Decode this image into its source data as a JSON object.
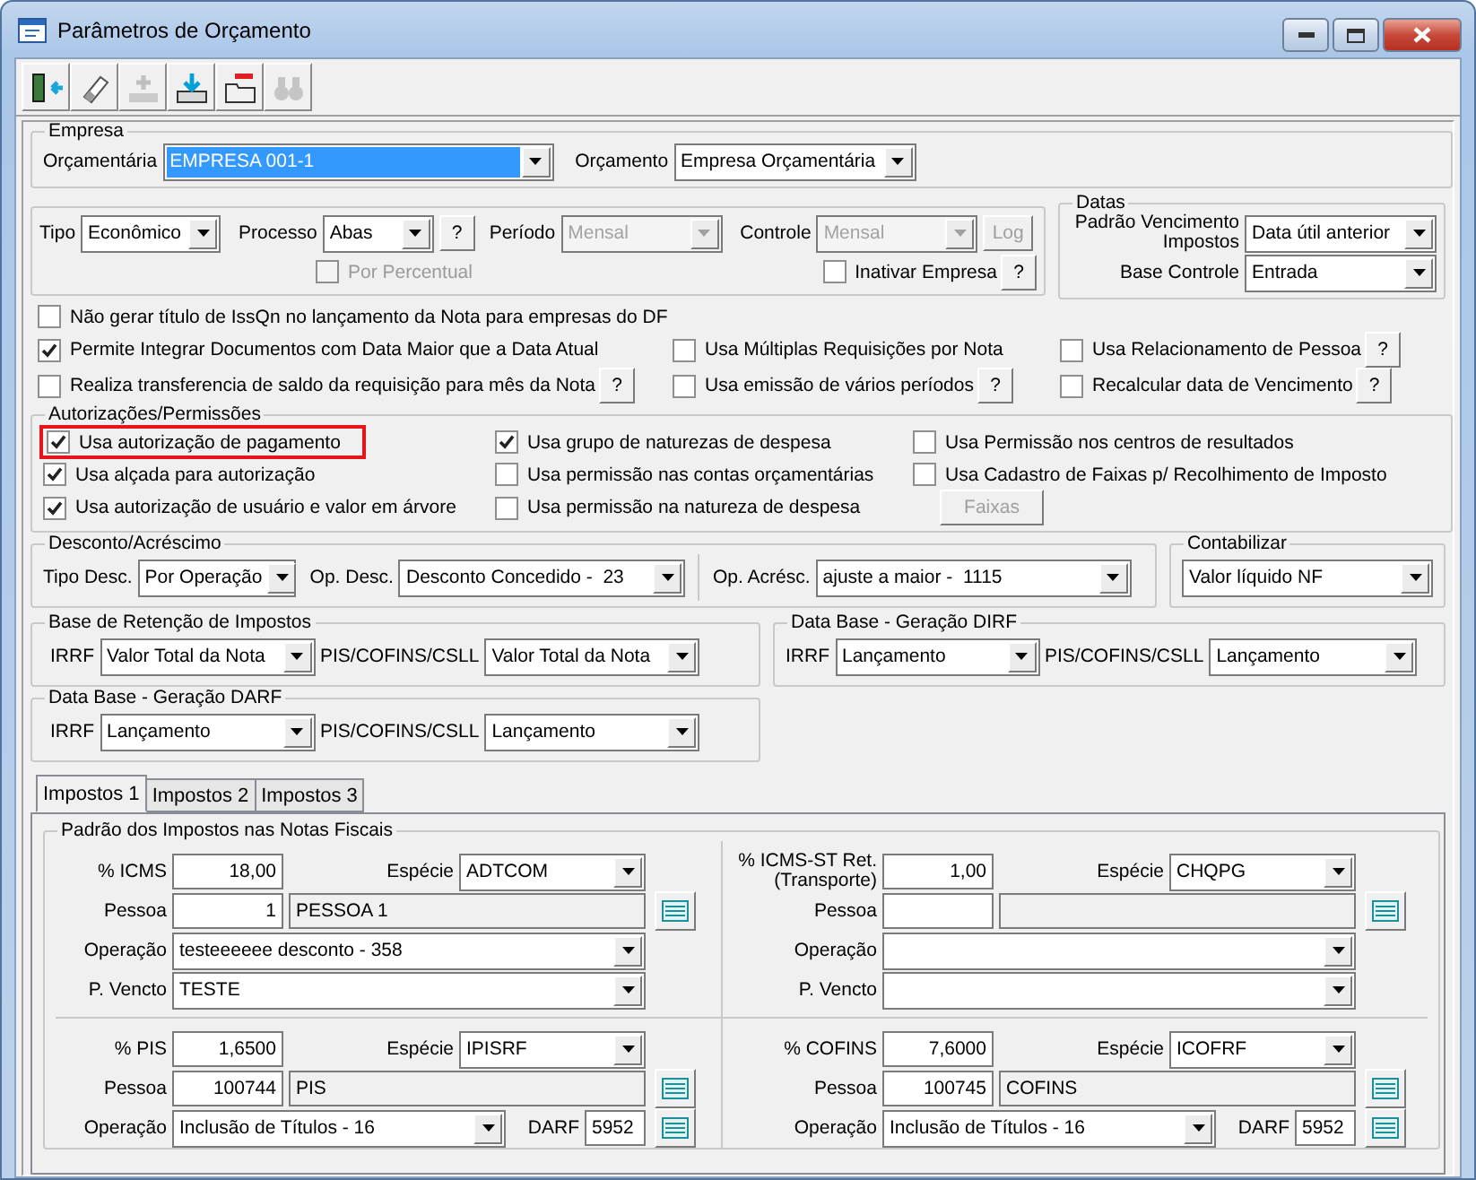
{
  "window": {
    "title": "Parâmetros de Orçamento"
  },
  "toolbar": [
    {
      "kind": "exit",
      "disabled": false
    },
    {
      "kind": "eraser",
      "disabled": false
    },
    {
      "kind": "add",
      "disabled": true
    },
    {
      "kind": "import",
      "disabled": false
    },
    {
      "kind": "remove",
      "disabled": false
    },
    {
      "kind": "search",
      "disabled": true
    }
  ],
  "empresa": {
    "title": "Empresa",
    "fields": [
      {
        "label": "Orçamentária",
        "value": "EMPRESA 001-1",
        "focused": true
      },
      {
        "label": "Orçamento",
        "value": "Empresa Orçamentária",
        "focused": false
      }
    ]
  },
  "geral": {
    "tipo": {
      "label": "Tipo",
      "value": "Econômico"
    },
    "processo": {
      "label": "Processo",
      "value": "Abas",
      "help": "?"
    },
    "periodo": {
      "label": "Período",
      "value": "Mensal",
      "disabled": true
    },
    "controle": {
      "label": "Controle",
      "value": "Mensal",
      "disabled": true
    },
    "log_button": {
      "label": "Log",
      "disabled": true
    },
    "por_percentual": {
      "label": "Por Percentual",
      "checked": false,
      "disabled": true
    },
    "inativar": {
      "label": "Inativar Empresa",
      "checked": false,
      "disabled": false,
      "help": "?"
    }
  },
  "datas": {
    "title": "Datas",
    "fields": [
      {
        "label": "Padrão Vencimento Impostos",
        "value": "Data útil anterior"
      },
      {
        "label": "Base Controle",
        "value": "Entrada"
      }
    ]
  },
  "opcoes": [
    [
      {
        "kind": "checkbox",
        "label": "Não gerar título de IssQn no lançamento da Nota para empresas do DF",
        "checked": false
      }
    ],
    [
      {
        "kind": "checkbox",
        "label": "Permite Integrar Documentos com Data Maior que a Data Atual",
        "checked": true
      },
      {
        "kind": "checkbox",
        "label": "Usa Múltiplas Requisições por Nota",
        "checked": false
      },
      {
        "kind": "checkbox",
        "label": "Usa Relacionamento de Pessoa",
        "checked": false,
        "help": "?"
      }
    ],
    [
      {
        "kind": "checkbox",
        "label": "Realiza transferencia de saldo da requisição para mês da Nota",
        "checked": false,
        "help": "?"
      },
      {
        "kind": "checkbox",
        "label": "Usa emissão de vários períodos",
        "checked": false,
        "help": "?"
      },
      {
        "kind": "checkbox",
        "label": "Recalcular data de Vencimento",
        "checked": false,
        "help": "?"
      }
    ]
  ],
  "autorizacoes": {
    "title": "Autorizações/Permissões",
    "rows": [
      [
        {
          "kind": "checkbox",
          "label": "Usa autorização de pagamento",
          "checked": true,
          "highlighted": true
        },
        {
          "kind": "checkbox",
          "label": "Usa grupo de naturezas de despesa",
          "checked": true
        },
        {
          "kind": "checkbox",
          "label": "Usa Permissão nos centros de resultados",
          "checked": false
        }
      ],
      [
        {
          "kind": "checkbox",
          "label": "Usa alçada para autorização",
          "checked": true
        },
        {
          "kind": "checkbox",
          "label": "Usa permissão nas contas orçamentárias",
          "checked": false
        },
        {
          "kind": "checkbox",
          "label": "Usa Cadastro de Faixas p/ Recolhimento de Imposto",
          "checked": false
        }
      ],
      [
        {
          "kind": "checkbox",
          "label": "Usa autorização de usuário e valor em árvore",
          "checked": true
        },
        {
          "kind": "checkbox",
          "label": "Usa permissão na natureza de despesa",
          "checked": false
        },
        {
          "kind": "button",
          "label": "Faixas",
          "disabled": true
        }
      ]
    ]
  },
  "desconto": {
    "title": "Desconto/Acréscimo",
    "fields": [
      {
        "label": "Tipo Desc.",
        "value": "Por Operação"
      },
      {
        "label": "Op. Desc.",
        "value": "Desconto Concedido -  23"
      },
      {
        "label": "Op. Acrésc.",
        "value": "ajuste a maior -  1115"
      }
    ]
  },
  "contabilizar": {
    "title": "Contabilizar",
    "value": "Valor líquido NF"
  },
  "retencao": {
    "title": "Base de Retenção de Impostos",
    "fields": [
      {
        "label": "IRRF",
        "value": "Valor Total da Nota"
      },
      {
        "label": "PIS/COFINS/CSLL",
        "value": "Valor Total da Nota"
      }
    ]
  },
  "dirf": {
    "title": "Data Base - Geração DIRF",
    "fields": [
      {
        "label": "IRRF",
        "value": "Lançamento"
      },
      {
        "label": "PIS/COFINS/CSLL",
        "value": "Lançamento"
      }
    ]
  },
  "darf": {
    "title": "Data Base - Geração DARF",
    "fields": [
      {
        "label": "IRRF",
        "value": "Lançamento"
      },
      {
        "label": "PIS/COFINS/CSLL",
        "value": "Lançamento"
      }
    ]
  },
  "tabs": [
    {
      "label": "Impostos 1",
      "selected": true
    },
    {
      "label": "Impostos 2",
      "selected": false
    },
    {
      "label": "Impostos 3",
      "selected": false
    }
  ],
  "impostos": {
    "title": "Padrão dos Impostos nas Notas Fiscais",
    "quadrants": [
      {
        "pct": {
          "label": "% ICMS",
          "value": "18,00"
        },
        "especie": {
          "label": "Espécie",
          "value": "ADTCOM"
        },
        "pessoa": {
          "label": "Pessoa",
          "code": "1",
          "name": "PESSOA 1"
        },
        "operacao": {
          "label": "Operação",
          "value": "testeeeeee desconto - 358"
        },
        "vencto": {
          "label": "P. Vencto",
          "value": "TESTE"
        }
      },
      {
        "pct": {
          "label": "% ICMS-ST Ret.(Transporte)",
          "value": "1,00"
        },
        "especie": {
          "label": "Espécie",
          "value": "CHQPG"
        },
        "pessoa": {
          "label": "Pessoa"
        },
        "operacao": {
          "label": "Operação"
        },
        "vencto": {
          "label": "P. Vencto"
        }
      },
      {
        "pct": {
          "label": "% PIS",
          "value": "1,6500"
        },
        "especie": {
          "label": "Espécie",
          "value": "IPISRF"
        },
        "pessoa": {
          "label": "Pessoa",
          "code": "100744",
          "name": "PIS"
        },
        "operacao": {
          "label": "Operação",
          "value": "Inclusão de Títulos - 16"
        },
        "darf": {
          "label": "DARF",
          "value": "5952"
        }
      },
      {
        "pct": {
          "label": "% COFINS",
          "value": "7,6000"
        },
        "especie": {
          "label": "Espécie",
          "value": "ICOFRF"
        },
        "pessoa": {
          "label": "Pessoa",
          "code": "100745",
          "name": "COFINS"
        },
        "operacao": {
          "label": "Operação",
          "value": "Inclusão de Títulos - 16"
        },
        "darf": {
          "label": "DARF",
          "value": "5952"
        }
      }
    ]
  }
}
